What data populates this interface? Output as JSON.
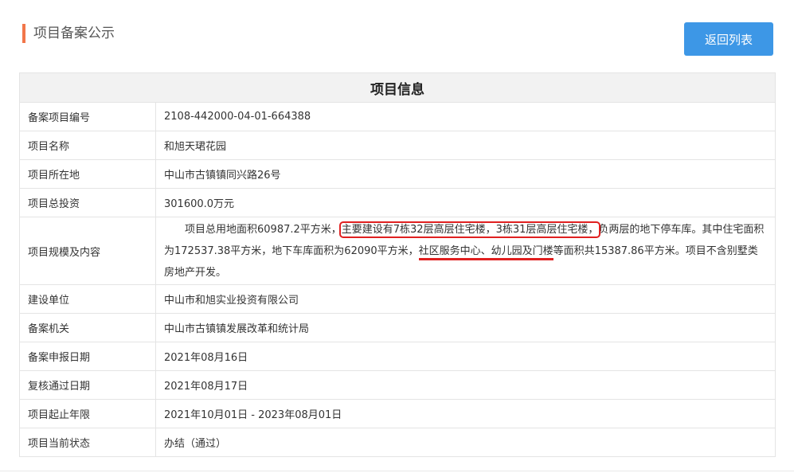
{
  "header": {
    "title": "项目备案公示",
    "back_button": "返回列表"
  },
  "table": {
    "heading": "项目信息",
    "rows": [
      {
        "label": "备案项目编号",
        "value": "2108-442000-04-01-664388"
      },
      {
        "label": "项目名称",
        "value": "和旭天珺花园"
      },
      {
        "label": "项目所在地",
        "value": "中山市古镇镇同兴路26号"
      },
      {
        "label": "项目总投资",
        "value": "301600.0万元"
      },
      {
        "label": "项目规模及内容"
      },
      {
        "label": "建设单位",
        "value": "中山市和旭实业投资有限公司"
      },
      {
        "label": "备案机关",
        "value": "中山市古镇镇发展改革和统计局"
      },
      {
        "label": "备案申报日期",
        "value": "2021年08月16日"
      },
      {
        "label": "复核通过日期",
        "value": "2021年08月17日"
      },
      {
        "label": "项目起止年限",
        "value": "2021年10月01日 - 2023年08月01日"
      },
      {
        "label": "项目当前状态",
        "value": "办结（通过）"
      }
    ],
    "scale": {
      "part1": "项目总用地面积60987.2平方米，",
      "highlight_box": "主要建设有7栋32层高层住宅楼，3栋31层高层住宅楼，",
      "part2": "负两层的地下停车库。其中住宅面积为172537.38平方米，地下车库面积为62090平方米，",
      "highlight_underline": "社区服务中心、幼儿园及门楼",
      "part3": "等面积共15387.86平方米。项目不含别墅类房地产开发。"
    }
  },
  "colors": {
    "accent_bar": "#f2764a",
    "button": "#3d97e6",
    "annotation": "#e02020"
  }
}
